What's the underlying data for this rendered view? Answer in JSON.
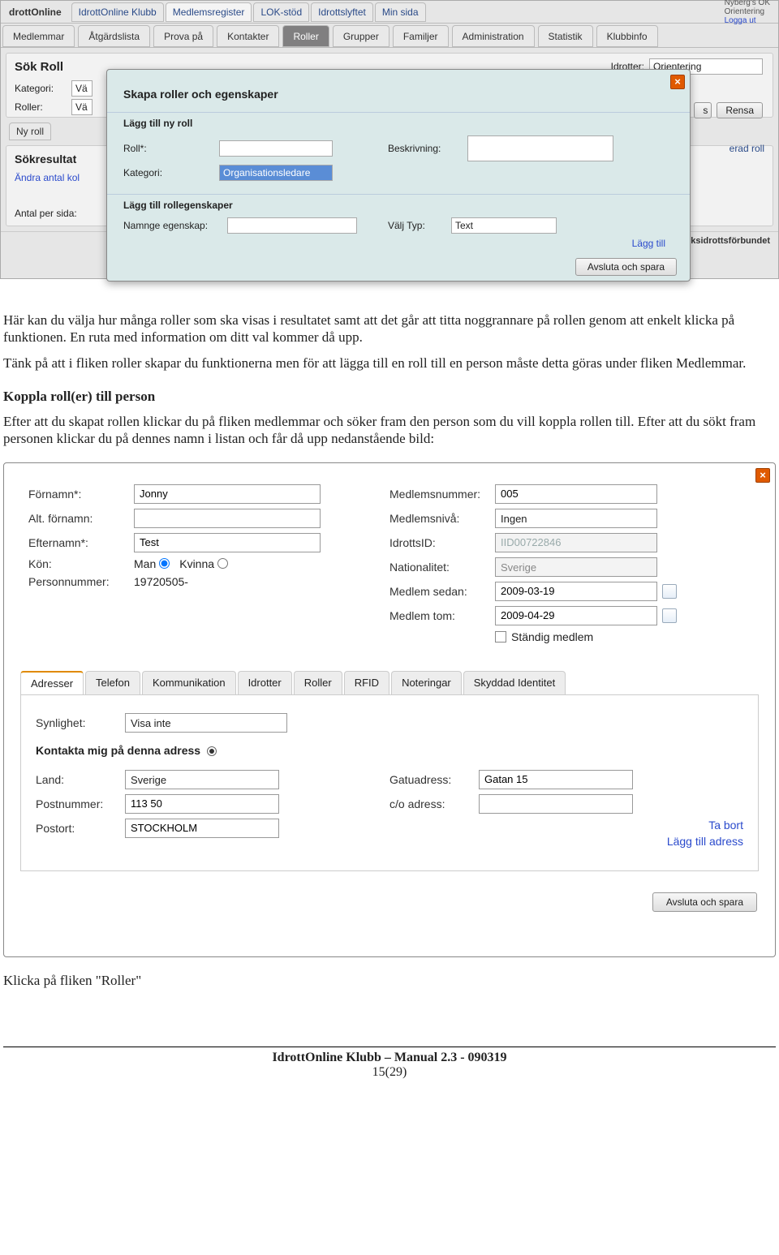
{
  "top": {
    "logo": "drottOnline",
    "tabs": [
      "IdrottOnline Klubb",
      "Medlemsregister",
      "LOK-stöd",
      "Idrottslyftet",
      "Min sida"
    ],
    "active_index": 1,
    "right_lines": [
      "Nyberg's OK",
      "Orientering",
      "Logga ut"
    ]
  },
  "main_tabs": {
    "items": [
      "Medlemmar",
      "Åtgärdslista",
      "Prova på",
      "Kontakter",
      "Roller",
      "Grupper",
      "Familjer",
      "Administration",
      "Statistik",
      "Klubbinfo"
    ],
    "active_index": 4
  },
  "search_panel": {
    "title": "Sök Roll",
    "lbl_kategori": "Kategori:",
    "lbl_roll": "Roller:",
    "val_prefix": "Vä",
    "lbl_idrotter": "Idrotter:",
    "sel_idrotter": "Orientering",
    "btn_search_suffix": "s",
    "btn_reset": "Rensa",
    "mini_tab": "Ny roll",
    "result_title": "Sökresultat",
    "result_link": "Ändra antal kol",
    "antal_per_sida": "Antal per sida:",
    "truncated_right": "erad roll"
  },
  "modal": {
    "title": "Skapa roller och egenskaper",
    "sec1_title": "Lägg till ny roll",
    "lbl_roll": "Roll*:",
    "lbl_beskrivning": "Beskrivning:",
    "lbl_kategori": "Kategori:",
    "val_kategori": "Organisationsledare",
    "sec2_title": "Lägg till rollegenskaper",
    "lbl_egenskap": "Namnge egenskap:",
    "lbl_typ": "Välj Typ:",
    "val_typ": "Text",
    "link_add": "Lägg till",
    "btn_save": "Avsluta och spara"
  },
  "footer_copy": "Riksidrottsförbundet",
  "body": {
    "p1": "Här kan du välja hur många roller som ska visas i resultatet samt att det går att titta noggrannare på rollen genom att enkelt klicka på funktionen. En ruta med information om ditt val kommer då upp.",
    "p2": "Tänk på att i fliken roller skapar du funktionerna men för att lägga till en roll till en person måste detta göras under fliken Medlemmar.",
    "h1": "Koppla roll(er) till person",
    "p3": "Efter att du skapat rollen klickar du på fliken medlemmar och söker fram den person som du vill koppla rollen till. Efter att du sökt fram personen klickar du på dennes namn i listan och får då upp nedanstående bild:"
  },
  "member": {
    "labels": {
      "fornamn": "Förnamn*:",
      "alt_fornamn": "Alt. förnamn:",
      "efternamn": "Efternamn*:",
      "kon": "Kön:",
      "man": "Man",
      "kvinna": "Kvinna",
      "personnummer": "Personnummer:",
      "medlemsnummer": "Medlemsnummer:",
      "medlemsniva": "Medlemsnivå:",
      "idrottsid": "IdrottsID:",
      "nationalitet": "Nationalitet:",
      "medlem_sedan": "Medlem sedan:",
      "medlem_tom": "Medlem tom:",
      "standig": "Ständig medlem"
    },
    "values": {
      "fornamn": "Jonny",
      "alt_fornamn": "",
      "efternamn": "Test",
      "personnummer": "19720505-",
      "medlemsnummer": "005",
      "medlemsniva": "Ingen",
      "idrottsid": "IID00722846",
      "nationalitet": "Sverige",
      "medlem_sedan": "2009-03-19",
      "medlem_tom": "2009-04-29"
    },
    "tabs": [
      "Adresser",
      "Telefon",
      "Kommunikation",
      "Idrotter",
      "Roller",
      "RFID",
      "Noteringar",
      "Skyddad Identitet"
    ],
    "active_tab": 0,
    "addr": {
      "lbl_synlighet": "Synlighet:",
      "val_synlighet": "Visa inte",
      "heading": "Kontakta mig på denna adress",
      "lbl_land": "Land:",
      "val_land": "Sverige",
      "lbl_postnr": "Postnummer:",
      "val_postnr": "113 50",
      "lbl_postort": "Postort:",
      "val_postort": "STOCKHOLM",
      "lbl_gatu": "Gatuadress:",
      "val_gatu": "Gatan 15",
      "lbl_co": "c/o adress:",
      "val_co": "",
      "link_remove": "Ta bort",
      "link_add": "Lägg till adress"
    },
    "btn_save": "Avsluta och spara"
  },
  "after_member_text": "Klicka på fliken \"Roller\"",
  "doc_footer": {
    "title": "IdrottOnline Klubb – Manual  2.3 - 090319",
    "page": "15(29)"
  }
}
